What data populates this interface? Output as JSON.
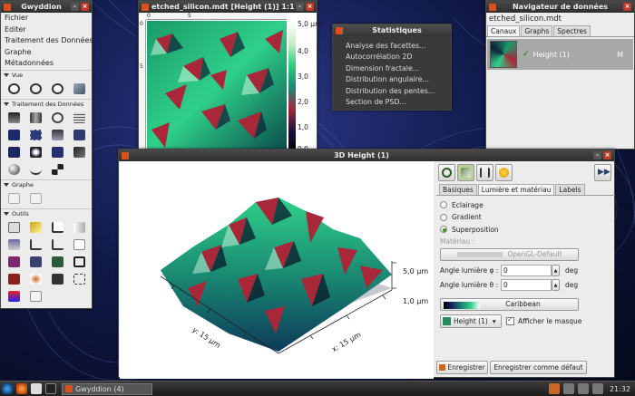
{
  "main_window": {
    "title": "Gwyddion",
    "menus": [
      "Fichier",
      "Editer",
      "Traitement des Données",
      "Graphe",
      "Métadonnées"
    ],
    "sections": {
      "view": "Vue",
      "processing": "Traitement des Données",
      "graph": "Graphe",
      "tools": "Outils"
    }
  },
  "data_window": {
    "title": "etched_silicon.mdt [Height (1)] 1:1",
    "ruler_top": [
      "0",
      "5"
    ],
    "ruler_left": [
      "0",
      "5"
    ],
    "colorbar_labels": [
      "5,0 µm",
      "4,0",
      "3,0",
      "2,0",
      "1,0",
      "0,0"
    ]
  },
  "stats_menu": {
    "title": "Statistiques",
    "items": [
      "Analyse des facettes...",
      "Autocorrélation 2D",
      "Dimension fractale...",
      "Distribution angulaire...",
      "Distribution des pentes...",
      "Section de PSD..."
    ]
  },
  "navigator": {
    "title": "Navigateur de données",
    "filename": "etched_silicon.mdt",
    "tabs": [
      "Canaux",
      "Graphs",
      "Spectres"
    ],
    "channel": {
      "name": "Height (1)",
      "mode": "M"
    }
  },
  "view3d": {
    "title": "3D Height (1)",
    "axis_x": "x: 15 µm",
    "axis_y": "y: 15 µm",
    "z_max": "5,0 µm",
    "z_min": "1,0 µm",
    "tabs": [
      "Basiques",
      "Lumière et matériau",
      "Labels"
    ],
    "modes": [
      "Eclairage",
      "Gradient",
      "Superposition"
    ],
    "selected_mode": "Superposition",
    "material_label": "Matériau :",
    "material": "OpenGL-Default",
    "angle_phi_label": "Angle lumière φ :",
    "angle_phi": "0",
    "angle_theta_label": "Angle lumière θ :",
    "angle_theta": "0",
    "unit": "deg",
    "gradient_name": "Caribbean",
    "overlay_channel": "Height (1)",
    "show_mask_label": "Afficher le masque",
    "save_label": "Enregistrer",
    "save_default_label": "Enregistrer comme défaut"
  },
  "taskbar": {
    "task_label": "Gwyddion (4)",
    "clock": "21:32"
  }
}
